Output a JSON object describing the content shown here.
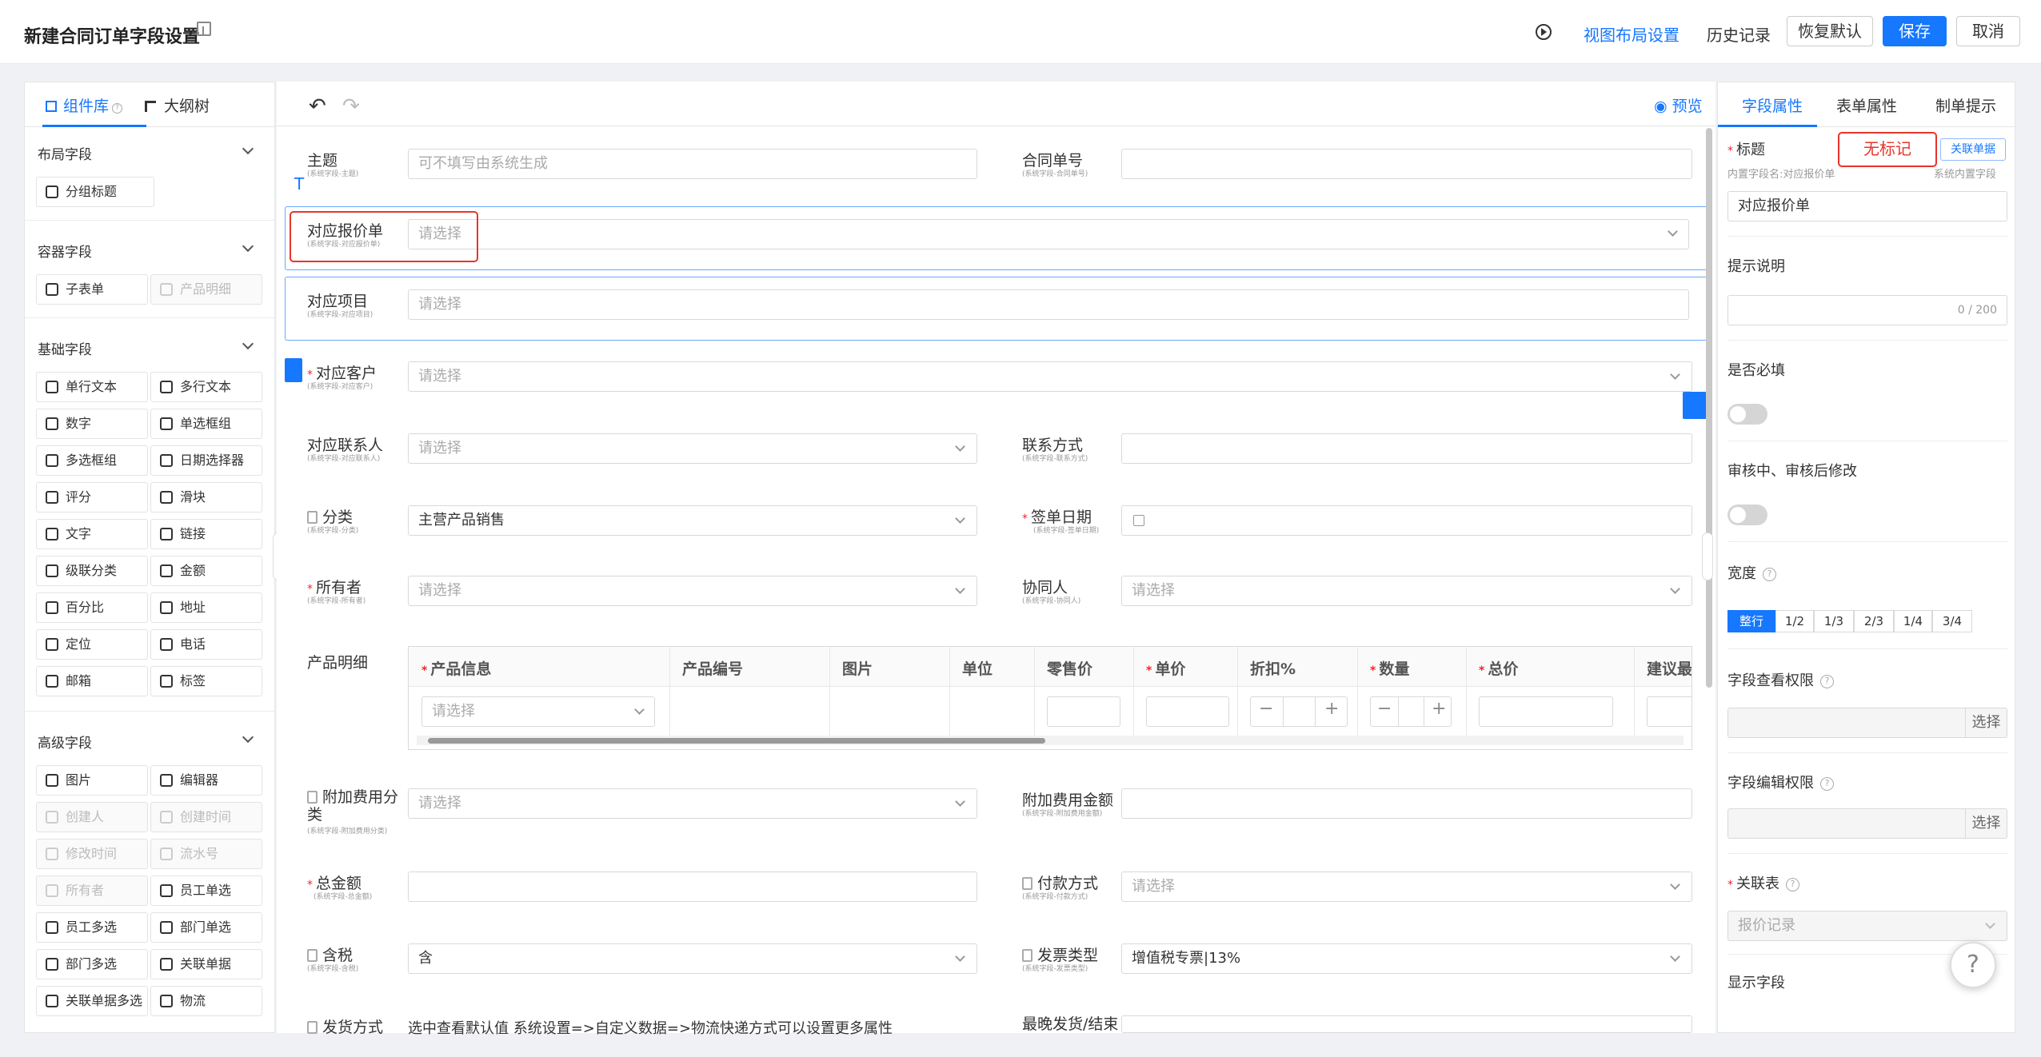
{
  "header": {
    "title": "新建合同订单字段设置",
    "view_layout": "视图布局设置",
    "history": "历史记录",
    "restore": "恢复默认",
    "save": "保存",
    "cancel": "取消"
  },
  "left": {
    "tabs": [
      "组件库",
      "大纲树"
    ],
    "groups": {
      "layout": "布局字段",
      "container": "容器字段",
      "basic": "基础字段",
      "advanced": "高级字段"
    },
    "layout_items": [
      "分组标题"
    ],
    "container_items": [
      "子表单",
      "产品明细"
    ],
    "basic_items": [
      "单行文本",
      "多行文本",
      "数字",
      "单选框组",
      "多选框组",
      "日期选择器",
      "评分",
      "滑块",
      "文字",
      "链接",
      "级联分类",
      "金额",
      "百分比",
      "地址",
      "定位",
      "电话",
      "邮箱",
      "标签"
    ],
    "advanced_items": [
      "图片",
      "编辑器",
      "创建人",
      "创建时间",
      "修改时间",
      "流水号",
      "所有者",
      "员工单选",
      "员工多选",
      "部门单选",
      "部门多选",
      "关联单据",
      "关联单据多选",
      "物流"
    ]
  },
  "center": {
    "preview": "预览",
    "fields": {
      "subject": {
        "label": "主题",
        "sub": "(系统字段-主题)",
        "placeholder": "可不填写由系统生成"
      },
      "contract_no": {
        "label": "合同单号",
        "sub": "(系统字段-合同单号)"
      },
      "quote": {
        "label": "对应报价单",
        "sub": "(系统字段-对应报价单)",
        "placeholder": "请选择"
      },
      "project": {
        "label": "对应项目",
        "sub": "(系统字段-对应项目)",
        "placeholder": "请选择"
      },
      "customer": {
        "label": "对应客户",
        "sub": "(系统字段-对应客户)",
        "placeholder": "请选择"
      },
      "contact": {
        "label": "对应联系人",
        "sub": "(系统字段-对应联系人)",
        "placeholder": "请选择"
      },
      "phone": {
        "label": "联系方式",
        "sub": "(系统字段-联系方式)"
      },
      "category": {
        "label": "分类",
        "sub": "(系统字段-分类)",
        "value": "主营产品销售"
      },
      "sign_date": {
        "label": "签单日期",
        "sub": "(系统字段-签单日期)"
      },
      "owner": {
        "label": "所有者",
        "sub": "(系统字段-所有者)",
        "placeholder": "请选择"
      },
      "collab": {
        "label": "协同人",
        "sub": "(系统字段-协同人)",
        "placeholder": "请选择"
      },
      "products": {
        "label": "产品明细"
      },
      "extra_cat": {
        "label": "附加费用分类",
        "sub": "(系统字段-附加费用分类)",
        "placeholder": "请选择"
      },
      "extra_amt": {
        "label": "附加费用金额",
        "sub": "(系统字段-附加费用金额)"
      },
      "total": {
        "label": "总金额",
        "sub": "(系统字段-总金额)"
      },
      "pay": {
        "label": "付款方式",
        "sub": "(系统字段-付款方式)",
        "placeholder": "请选择"
      },
      "tax": {
        "label": "含税",
        "sub": "(系统字段-含税)",
        "value": "含"
      },
      "invoice": {
        "label": "发票类型",
        "sub": "(系统字段-发票类型)",
        "value": "增值税专票|13%"
      },
      "ship": {
        "label": "发货方式",
        "value": "选中查看默认值 系统设置=>自定义数据=>物流快递方式可以设置更多属性"
      },
      "latest": {
        "label": "最晚发货/结束"
      }
    },
    "table": {
      "headers": [
        "产品信息",
        "产品编号",
        "图片",
        "单位",
        "零售价",
        "单价",
        "折扣%",
        "数量",
        "总价",
        "建议最低"
      ],
      "select_placeholder": "请选择"
    }
  },
  "right": {
    "tabs": [
      "字段属性",
      "表单属性",
      "制单提示"
    ],
    "title_label": "标题",
    "no_mark": "无标记",
    "link_btn": "关联单据",
    "inner_name": "内置字段名:对应报价单",
    "sys_inner": "系统内置字段",
    "title_value": "对应报价单",
    "hint_label": "提示说明",
    "hint_count": "0 / 200",
    "required_label": "是否必填",
    "audit_label": "审核中、审核后修改",
    "width_label": "宽度",
    "widths": [
      "整行",
      "1/2",
      "1/3",
      "2/3",
      "1/4",
      "3/4"
    ],
    "view_perm": "字段查看权限",
    "edit_perm": "字段编辑权限",
    "pick": "选择",
    "link_table": "关联表",
    "link_table_value": "报价记录",
    "display_field": "显示字段"
  }
}
